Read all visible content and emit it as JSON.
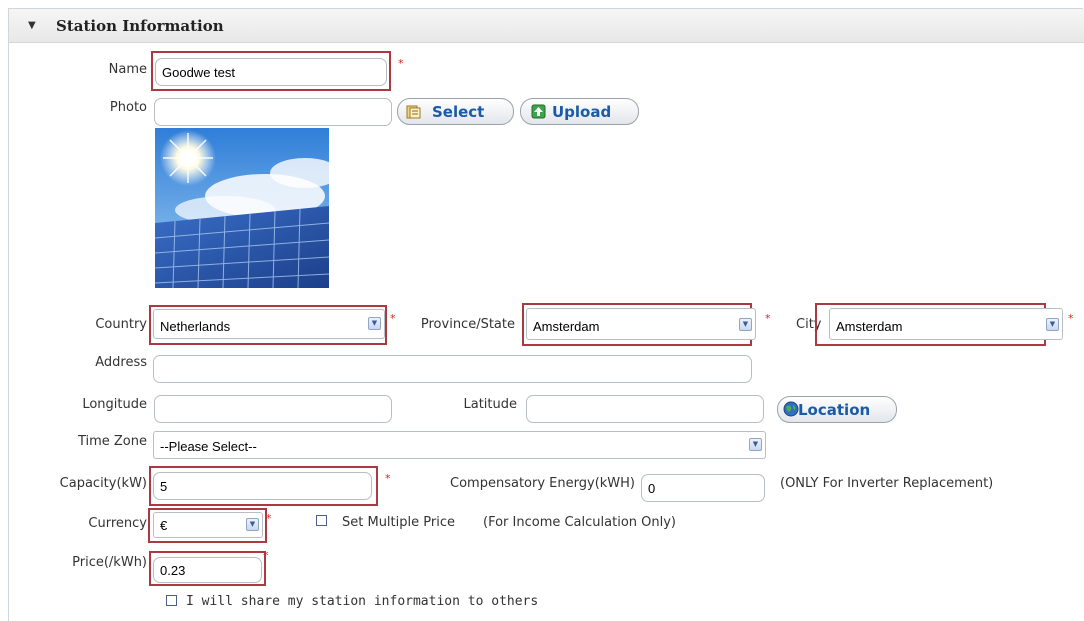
{
  "section": {
    "title": "Station Information"
  },
  "fields": {
    "name": {
      "label": "Name",
      "value": "Goodwe test"
    },
    "photo": {
      "label": "Photo",
      "value": "",
      "select_label": "Select",
      "upload_label": "Upload"
    },
    "country": {
      "label": "Country",
      "value": "Netherlands"
    },
    "province": {
      "label": "Province/State",
      "value": "Amsterdam"
    },
    "city": {
      "label": "City",
      "value": "Amsterdam"
    },
    "address": {
      "label": "Address",
      "value": ""
    },
    "longitude": {
      "label": "Longitude",
      "value": ""
    },
    "latitude": {
      "label": "Latitude",
      "value": ""
    },
    "location_button": "Location",
    "timezone": {
      "label": "Time Zone",
      "value": "--Please Select--"
    },
    "capacity": {
      "label": "Capacity(kW)",
      "value": "5"
    },
    "compensatory": {
      "label": "Compensatory Energy(kWH)",
      "value": "0",
      "note": "(ONLY For Inverter Replacement)"
    },
    "currency": {
      "label": "Currency",
      "value": "€"
    },
    "multiple_price": {
      "label": "Set Multiple Price",
      "note": "(For Income Calculation Only)"
    },
    "price": {
      "label": "Price(/kWh)",
      "value": "0.23"
    },
    "share": {
      "label": "I will share my station information to others"
    }
  },
  "required_mark": "*",
  "colors": {
    "required_box": "#a93a41",
    "button_text": "#1a5aa8",
    "required_star": "#e02020"
  }
}
